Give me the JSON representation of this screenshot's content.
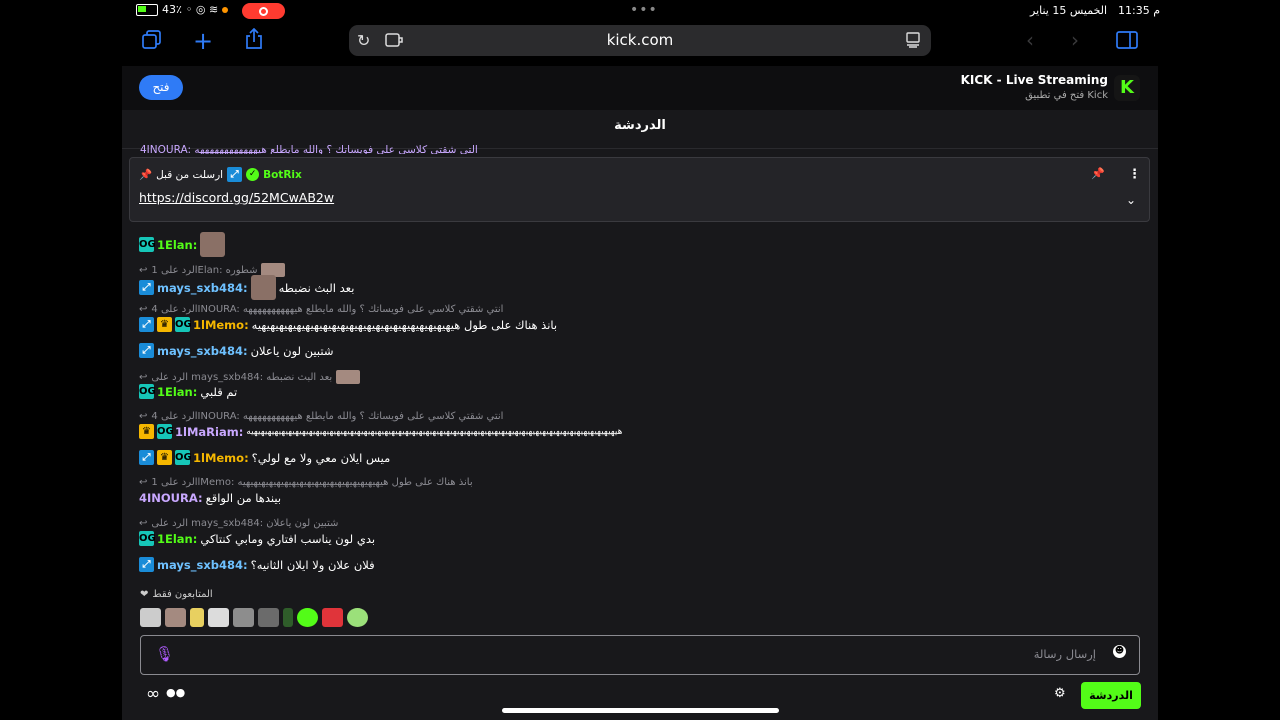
{
  "status": {
    "time": "11:35 م",
    "date": "الخميس 15 يناير",
    "battery": "43٪"
  },
  "browser": {
    "url": "kick.com"
  },
  "banner": {
    "app_name": "KICK - Live Streaming",
    "app_subtitle": "فتح في تطبيق Kick",
    "open_label": "فتح",
    "logo_letter": "K"
  },
  "chat": {
    "title": "الدردشة",
    "pinned": {
      "label": "ارسلت من قبل",
      "author": "BotRix",
      "link": "https://discord.gg/52MCwAB2w"
    },
    "top_cut_message": "4INOURA: التي شقتي كلاسي على فويساتك ؟ والله مايطلع هيههههههههههههه",
    "messages": [
      {
        "type": "msg",
        "user": "1Elan:",
        "text": ""
      },
      {
        "type": "reply",
        "reply": "الرد على 1Elan: شطوره"
      },
      {
        "type": "msg",
        "user": "mays_sxb484:",
        "text": "بعد البث نضبطه"
      },
      {
        "type": "reply",
        "reply": "الرد على 4INOURA: انتي شقتي كلاسي على فويساتك ؟ والله مايطلع هيههههههههههه"
      },
      {
        "type": "msg",
        "user": "1lMemo:",
        "text": "بانذ هناك على طول هيهيهيهيهيهيهيهيهيهيهيهيهيهيهيهيهيهيهيهيهيهيهيه"
      },
      {
        "type": "msg",
        "user": "mays_sxb484:",
        "text": "شتبين لون ياعلان"
      },
      {
        "type": "reply",
        "reply": "الرد على mays_sxb484: بعد البث نضبطه"
      },
      {
        "type": "msg",
        "user": "1Elan:",
        "text": "تم قلبي"
      },
      {
        "type": "reply",
        "reply": "الرد على 4INOURA: انتي شقتي كلاسي على فويساتك ؟ والله مايطلع هيههههههههههه"
      },
      {
        "type": "msg",
        "user": "1lMaRiam:",
        "text": "هيهيهيهيهيهيهيهيهيهيهيهيهيهيهيهيهيهيهيهيهيهيهيهيهيهيهيهيهيهيهيهيهيهيهيهيهيهيهيهيهيهيهيهيهيهيهيهيهيهيهيهيهيهيه"
      },
      {
        "type": "msg",
        "user": "1lMemo:",
        "text": "ميس ايلان معي ولا مع لولي؟"
      },
      {
        "type": "reply",
        "reply": "الرد على 1lMemo: بانذ هناك على طول هيهيهيهيهيهيهيهيهيهيهيهيهيهيهيهيهيهيهيه"
      },
      {
        "type": "msg",
        "user": "4INOURA:",
        "text": "بيندها من الواقع"
      },
      {
        "type": "reply",
        "reply": "الرد على mays_sxb484: شتبين لون ياعلان"
      },
      {
        "type": "msg",
        "user": "1Elan:",
        "text": "بدي لون يناسب افتاري ومابي كنتاكي"
      },
      {
        "type": "msg",
        "user": "mays_sxb484:",
        "text": "فلان علان ولا ايلان الثانيه؟"
      }
    ],
    "followers_only": "المتابعون فقط",
    "input_placeholder": "إرسال رسالة",
    "send_label": "الدردشة"
  },
  "colors": {
    "kick_green": "#53fc18",
    "ios_blue": "#2f7bf6",
    "user_green": "#53fc18",
    "user_purple": "#b57cff",
    "user_gold": "#f5b700",
    "user_blue": "#6ec1ff"
  }
}
